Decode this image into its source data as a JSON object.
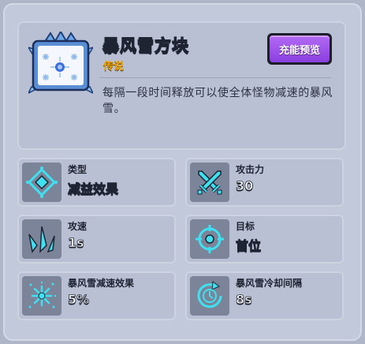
{
  "item": {
    "name": "暴风雪方块",
    "rarity": "传说",
    "rarity_color": "#f0a400",
    "description": "每隔一段时间释放可以使全体怪物减速的暴风雪。",
    "icon": "snowflake-block-icon"
  },
  "preview_button": {
    "label": "充能预览",
    "color": "#9b52ea"
  },
  "stats": [
    {
      "label": "类型",
      "value": "减益效果",
      "icon": "debuff-diamond-icon"
    },
    {
      "label": "攻击力",
      "value": "30",
      "icon": "crossed-swords-icon"
    },
    {
      "label": "攻速",
      "value": "1s",
      "icon": "speed-spikes-icon"
    },
    {
      "label": "目标",
      "value": "首位",
      "icon": "crosshair-target-icon"
    },
    {
      "label": "暴风雪减速效果",
      "value": "5%",
      "icon": "snow-burst-icon"
    },
    {
      "label": "暴风雪冷却间隔",
      "value": "8s",
      "icon": "cooldown-clock-icon"
    }
  ],
  "accent_color": "#3fe0f0"
}
